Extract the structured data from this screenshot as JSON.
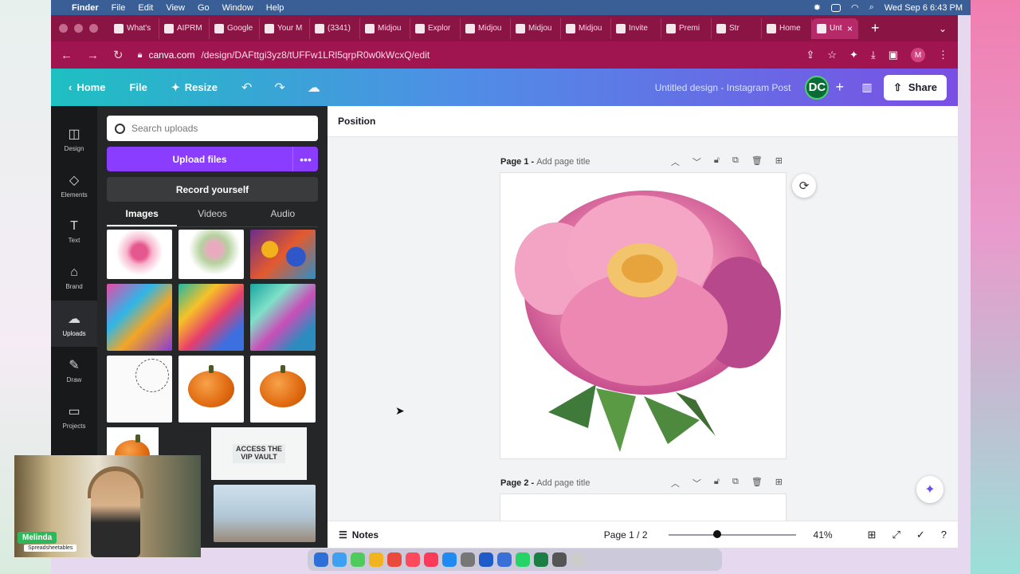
{
  "menubar": {
    "app": "Finder",
    "menus": [
      "File",
      "Edit",
      "View",
      "Go",
      "Window",
      "Help"
    ],
    "datetime": "Wed Sep 6  6:43 PM"
  },
  "browser": {
    "tabs": [
      "What's",
      "AIPRM",
      "Google",
      "Your M",
      "(3341)",
      "Midjou",
      "Explor",
      "Midjou",
      "Midjou",
      "Midjou",
      "Invite",
      "Premi",
      "Str",
      "Home"
    ],
    "active_tab": "Unt",
    "url_host": "canva.com",
    "url_path": "/design/DAFttgi3yz8/tUFFw1LRl5qrpR0w0kWcxQ/edit"
  },
  "canva_header": {
    "home": "Home",
    "file": "File",
    "resize": "Resize",
    "title": "Untitled design - Instagram Post",
    "avatar_initials": "DC",
    "share": "Share"
  },
  "rail": {
    "items": [
      "Design",
      "Elements",
      "Text",
      "Brand",
      "Uploads",
      "Draw",
      "Projects"
    ],
    "active": "Uploads"
  },
  "uploads_panel": {
    "search_placeholder": "Search uploads",
    "upload_button": "Upload files",
    "record_button": "Record yourself",
    "tabs": [
      "Images",
      "Videos",
      "Audio"
    ],
    "active_tab": "Images",
    "vip_text_line1": "ACCESS THE",
    "vip_text_line2": "VIP VAULT"
  },
  "editor": {
    "toolbar_label": "Position",
    "page1_label": "Page 1 -",
    "page1_sub": "Add page title",
    "page2_label": "Page 2 -",
    "page2_sub": "Add page title"
  },
  "footer": {
    "notes": "Notes",
    "page_indicator": "Page 1 / 2",
    "zoom": "41%",
    "zoom_level": 0.41
  },
  "webcam": {
    "name": "Melinda",
    "subtitle": "Spreadsheetables"
  },
  "colors": {
    "tabbar": "#8a1545",
    "upload_button": "#8b3dff",
    "panel_bg": "#252627"
  }
}
